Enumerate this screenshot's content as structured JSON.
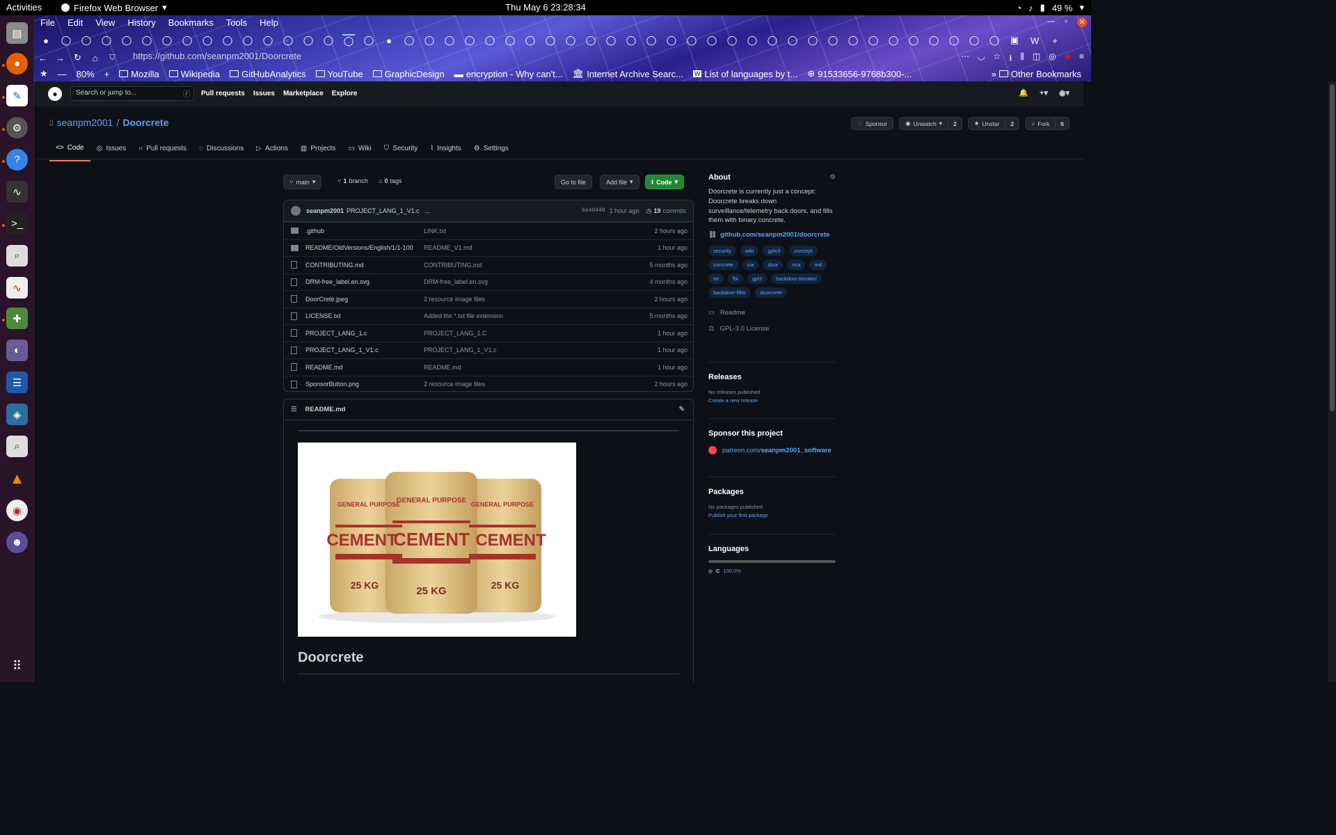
{
  "system": {
    "activities": "Activities",
    "app_name": "Firefox Web Browser",
    "clock": "Thu May 6  23:28:34",
    "battery": "49 %"
  },
  "browser": {
    "menu": [
      "File",
      "Edit",
      "View",
      "History",
      "Bookmarks",
      "Tools",
      "Help"
    ],
    "url": "https://github.com/seanpm2001/Doorcrete",
    "zoom": "80%",
    "bookmarks": [
      "Mozilla",
      "Wikipedia",
      "GitHubAnalytics",
      "YouTube",
      "GraphicDesign",
      "encryption - Why can't...",
      "Internet Archive Searc...",
      "List of languages by t...",
      "91533656-9768b300-..."
    ],
    "other_bookmarks": "Other Bookmarks"
  },
  "github": {
    "search_placeholder": "Search or jump to...",
    "search_key": "/",
    "nav": [
      "Pull requests",
      "Issues",
      "Marketplace",
      "Explore"
    ],
    "owner": "seanpm2001",
    "repo": "Doorcrete",
    "actions": {
      "sponsor": "Sponsor",
      "unwatch": "Unwatch",
      "unwatch_count": "2",
      "unstar": "Unstar",
      "star_count": "2",
      "fork": "Fork",
      "fork_count": "6"
    },
    "tabs": [
      "Code",
      "Issues",
      "Pull requests",
      "Discussions",
      "Actions",
      "Projects",
      "Wiki",
      "Security",
      "Insights",
      "Settings"
    ],
    "branch": "main",
    "branch_count": "1",
    "branch_label": "branch",
    "tag_count": "0",
    "tag_label": "tags",
    "go_to_file": "Go to file",
    "add_file": "Add file",
    "code_btn": "Code",
    "commit": {
      "author": "seanpm2001",
      "message": "PROJECT_LANG_1_V1.c",
      "ellipsis": "...",
      "hash": "6a4d448",
      "time": "1 hour ago",
      "count": "19",
      "count_label": "commits"
    },
    "files": [
      {
        "name": ".github",
        "msg": "LINK.txt",
        "age": "2 hours ago",
        "dir": true
      },
      {
        "name": "README/OldVersions/English/1/1-100",
        "msg": "README_V1.md",
        "age": "1 hour ago",
        "dir": true
      },
      {
        "name": "CONTRIBUTING.md",
        "msg": "CONTRIBUTING.md",
        "age": "5 months ago",
        "dir": false
      },
      {
        "name": "DRM-free_label.en.svg",
        "msg": "DRM-free_label.en.svg",
        "age": "4 months ago",
        "dir": false
      },
      {
        "name": "DoorCrete.jpeg",
        "msg": "2 resource image files",
        "age": "2 hours ago",
        "dir": false
      },
      {
        "name": "LICENSE.txt",
        "msg": "Added the *.txt file extension",
        "age": "5 months ago",
        "dir": false
      },
      {
        "name": "PROJECT_LANG_1.c",
        "msg": "PROJECT_LANG_1.C",
        "age": "1 hour ago",
        "dir": false
      },
      {
        "name": "PROJECT_LANG_1_V1.c",
        "msg": "PROJECT_LANG_1_V1.c",
        "age": "1 hour ago",
        "dir": false
      },
      {
        "name": "README.md",
        "msg": "README.md",
        "age": "1 hour ago",
        "dir": false
      },
      {
        "name": "SponsorButton.png",
        "msg": "2 resource image files",
        "age": "2 hours ago",
        "dir": false
      }
    ],
    "readme": {
      "filename": "README.md",
      "bag_top": "GENERAL PURPOSE",
      "bag_word": "CEMENT",
      "bag_weight": "25 KG",
      "heading": "Doorcrete"
    },
    "about": {
      "title": "About",
      "description": "Doorcrete is currently just a concept: Doorcrete breaks down surveillance/telemetry back doors, and fills them with binary concrete.",
      "link": "github.com/seanpm2001/doorcrete",
      "topics": [
        "security",
        "wiki",
        "gplv3",
        "concept",
        "concrete",
        "cia",
        "door",
        "nsa",
        "md",
        "txt",
        "fbi",
        "gpl3",
        "backdoor-breaker",
        "backdoor-filler",
        "doorcrete"
      ],
      "readme": "Readme",
      "license": "GPL-3.0 License"
    },
    "releases": {
      "title": "Releases",
      "none": "No releases published",
      "create": "Create a new release"
    },
    "sponsor": {
      "title": "Sponsor this project",
      "link_prefix": "patreon.com/",
      "link_bold": "seanpm2001_software"
    },
    "packages": {
      "title": "Packages",
      "none": "No packages published",
      "publish": "Publish your first package"
    },
    "languages": {
      "title": "Languages",
      "name": "C",
      "pct": "100.0%"
    }
  },
  "colors": {
    "accent": "#58a6ff",
    "green": "#238636",
    "tab_underline": "#f78166",
    "ubuntu_orange": "#e95420"
  }
}
